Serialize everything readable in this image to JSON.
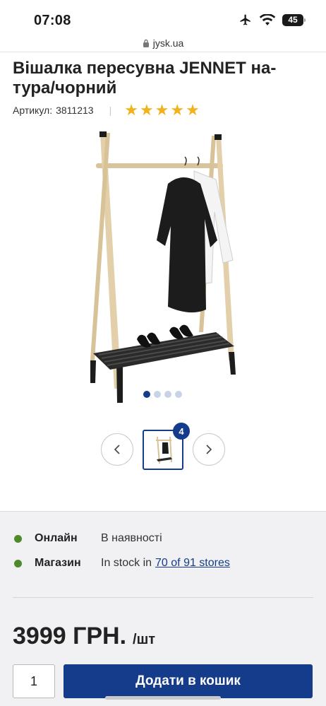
{
  "status": {
    "time": "07:08",
    "battery": "45"
  },
  "browser": {
    "domain": "jysk.ua"
  },
  "product": {
    "title": "Вішалка пересувна JENNET на-тура/чорний",
    "article_label": "Артикул:",
    "article_number": "3811213",
    "rating_stars": 5
  },
  "gallery": {
    "image_count": 4,
    "active_index": 0,
    "thumbnail_badge": "4"
  },
  "availability": {
    "online_label": "Онлайн",
    "online_status": "В наявності",
    "store_label": "Магазин",
    "store_status": "In stock in",
    "store_link": "70 of 91 stores"
  },
  "pricing": {
    "price": "3999 ГРН.",
    "unit": "/шт"
  },
  "cart": {
    "quantity": "1",
    "add_button_label": "Додати в кошик"
  },
  "colors": {
    "brand_blue": "#143c8a",
    "star_yellow": "#f2b21b",
    "available_green": "#4f8a2a"
  }
}
